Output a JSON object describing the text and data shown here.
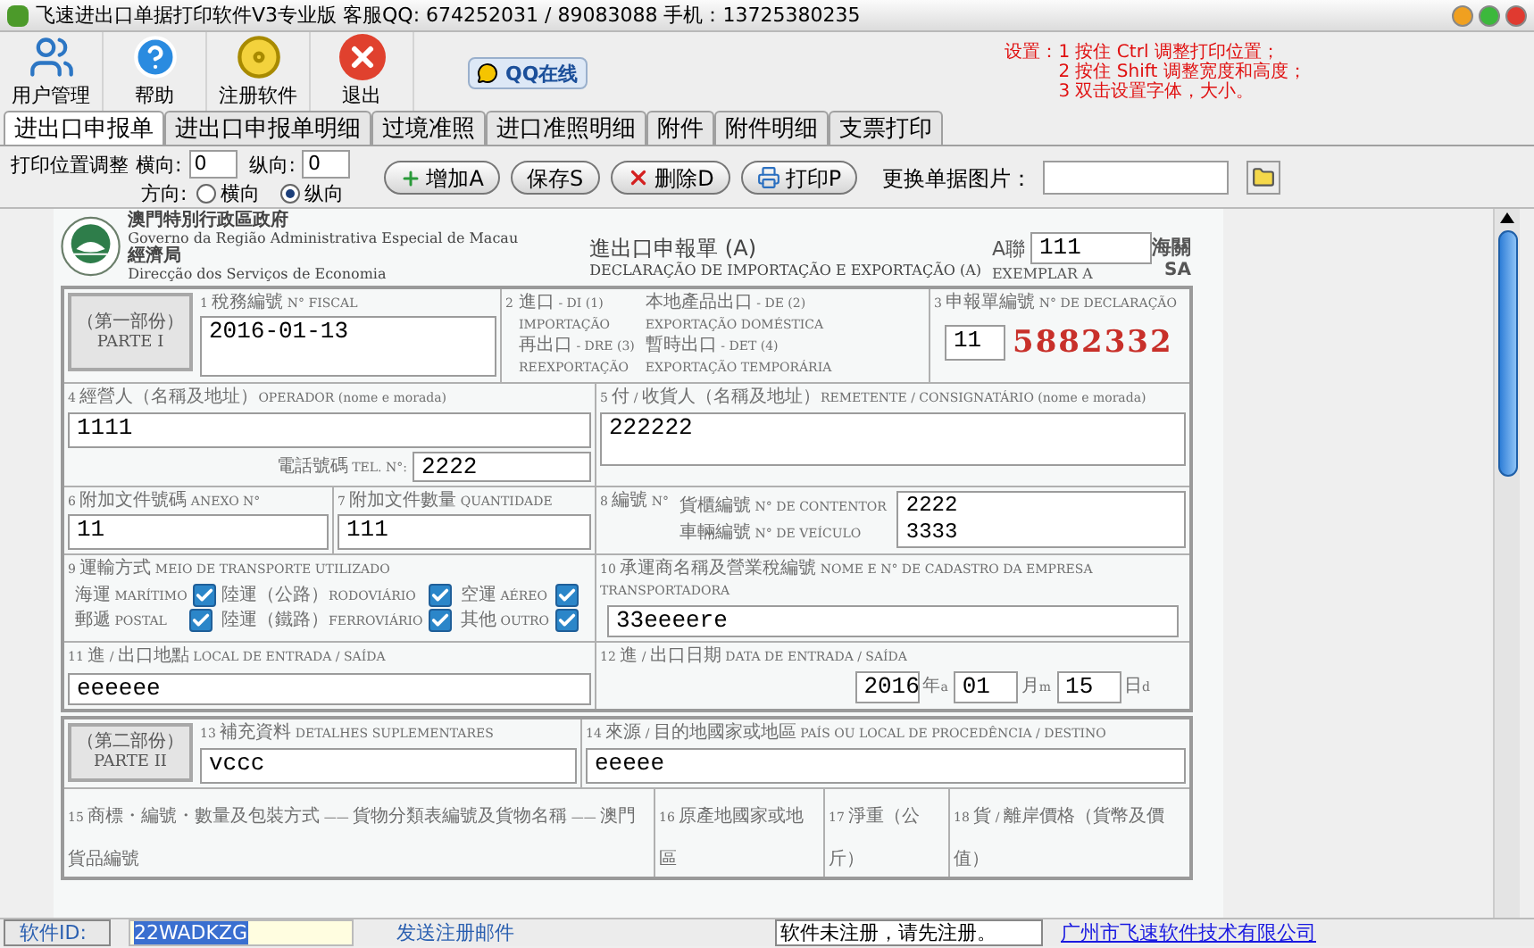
{
  "window": {
    "title": "飞速进出口单据打印软件V3专业版 客服QQ: 674252031 / 89083088 手机：13725380235"
  },
  "window_controls": [
    {
      "kind": "minimize"
    },
    {
      "kind": "maximize"
    },
    {
      "kind": "close"
    }
  ],
  "toolbar": [
    {
      "label": "用户管理",
      "kind": "users"
    },
    {
      "label": "帮助",
      "kind": "help"
    },
    {
      "label": "注册软件",
      "kind": "register"
    },
    {
      "label": "退出",
      "kind": "exit"
    }
  ],
  "qq_button": {
    "label": "QQ在线"
  },
  "hint": {
    "lines": [
      "设置：1 按住 Ctrl  调整打印位置；",
      "2 按住 Shift 调整宽度和高度；",
      "3 双击设置字体，大小。"
    ]
  },
  "tabs": [
    {
      "label": "进出口申报单",
      "selected": true
    },
    {
      "label": "进出口申报单明细",
      "selected": false
    },
    {
      "label": "过境准照",
      "selected": false
    },
    {
      "label": "进口准照明细",
      "selected": false
    },
    {
      "label": "附件",
      "selected": false
    },
    {
      "label": "附件明细",
      "selected": false
    },
    {
      "label": "支票打印",
      "selected": false
    }
  ],
  "print_adjust": {
    "label": "打印位置调整",
    "horizontal_label": "横向:",
    "horizontal_value": "0",
    "vertical_label": "纵向:",
    "vertical_value": "0",
    "direction_label": "方向:",
    "directions": [
      {
        "label": "横向",
        "selected": false
      },
      {
        "label": "纵向",
        "selected": true
      }
    ]
  },
  "actions": [
    {
      "label": "增加A",
      "kind": "add"
    },
    {
      "label": "保存S",
      "kind": "save"
    },
    {
      "label": "删除D",
      "kind": "delete"
    },
    {
      "label": "打印P",
      "kind": "print"
    }
  ],
  "image_picker": {
    "label": "更换单据图片："
  },
  "form": {
    "header": {
      "gov_zh": "澳門特別行政區政府",
      "gov_pt": "Governo da Região Administrativa Especial de Macau",
      "dept_zh": "經濟局",
      "dept_pt": "Direcção dos Serviços de Economia",
      "title_zh": "進出口申報單 (A)",
      "title_pt": "DECLARAÇÃO DE IMPORTAÇÃO E EXPORTAÇÃO (A)",
      "copy_zh": "A聯",
      "copy_value": "111",
      "copy_pt": "EXEMPLAR A",
      "customs_zh": "海關",
      "customs_pt": "SA"
    },
    "part1": {
      "label_zh": "（第一部份）",
      "label_pt": "PARTE I",
      "fiscal": {
        "label": "1 稅務編號 N° FISCAL",
        "value": "2016-01-13"
      },
      "type": {
        "label": "2",
        "options": [
          {
            "zh": "進口 - DI (1)",
            "pt": "IMPORTAÇÃO"
          },
          {
            "zh": "本地產品出口 - DE (2)",
            "pt": "EXPORTAÇÃO DOMÉSTICA"
          },
          {
            "zh": "再出口 - DRE (3)",
            "pt": "REEXPORTAÇÃO"
          },
          {
            "zh": "暫時出口 - DET (4)",
            "pt": "EXPORTAÇÃO TEMPORÁRIA"
          }
        ]
      },
      "declaration": {
        "label": "3 申報單編號 N° DE DECLARAÇÃO",
        "value": "11",
        "number": "5882332"
      },
      "operator": {
        "label": "4 經營人（名稱及地址）OPERADOR (nome e morada)",
        "value": "1111",
        "tel_label": "電話號碼 TEL. N°:",
        "tel_value": "2222"
      },
      "consignee": {
        "label": "5 付 / 收貨人（名稱及地址）REMETENTE / CONSIGNATÁRIO (nome e morada)",
        "value": "222222"
      },
      "annex": {
        "label": "6 附加文件號碼 ANEXO N°",
        "value": "11"
      },
      "quantity": {
        "label": "7 附加文件數量 QUANTIDADE",
        "value": "111"
      },
      "number": {
        "label": "8 編號 N°",
        "container_label": "貨櫃編號 N° DE CONTENTOR",
        "vehicle_label": "車輛編號 N° DE VEÍCULO",
        "values": [
          "2222",
          "3333"
        ]
      },
      "transport": {
        "label": "9 運輸方式 MEIO DE TRANSPORTE UTILIZADO",
        "modes": [
          {
            "label": "海運 MARÍTIMO",
            "checked": true
          },
          {
            "label": "陸運（公路）RODOVIÁRIO",
            "checked": true
          },
          {
            "label": "空運 AÉREO",
            "checked": true
          },
          {
            "label": "郵遞 POSTAL",
            "checked": true
          },
          {
            "label": "陸運（鐵路）FERROVIÁRIO",
            "checked": true
          },
          {
            "label": "其他 OUTRO",
            "checked": true
          }
        ]
      },
      "carrier": {
        "label": "10 承運商名稱及營業稅編號 NOME E N° DE CADASTRO DA EMPRESA TRANSPORTADORA",
        "value": "33eeeere"
      },
      "place": {
        "label": "11 進 / 出口地點 LOCAL DE ENTRADA / SAÍDA",
        "value": "eeeeee"
      },
      "date": {
        "label": "12 進 / 出口日期 DATA DE ENTRADA / SAÍDA",
        "parts": [
          {
            "value": "2016",
            "unit": "年a"
          },
          {
            "value": "01",
            "unit": "月m"
          },
          {
            "value": "15",
            "unit": "日d"
          }
        ]
      }
    },
    "part2": {
      "label_zh": "（第二部份）",
      "label_pt": "PARTE II",
      "details": {
        "label": "13 補充資料 DETALHES SUPLEMENTARES",
        "value": "vccc"
      },
      "origin": {
        "label": "14 來源 / 目的地國家或地區 PAÍS OU LOCAL DE PROCEDÊNCIA / DESTINO",
        "value": "eeeee"
      },
      "columns": [
        "15 商標・編號・數量及包裝方式 —— 貨物分類表編號及貨物名稱 —— 澳門貨品編號",
        "16 原產地國家或地區",
        "17 淨重（公斤）",
        "18 貨 / 離岸價格（貨幣及價值）"
      ]
    }
  },
  "status_bar": {
    "id_label": "软件ID:",
    "id_value": "22WADKZG",
    "register_link": "发送注册邮件",
    "notice": "软件未注册，请先注册。",
    "company_link": "广州市飞速软件技术有限公司"
  }
}
